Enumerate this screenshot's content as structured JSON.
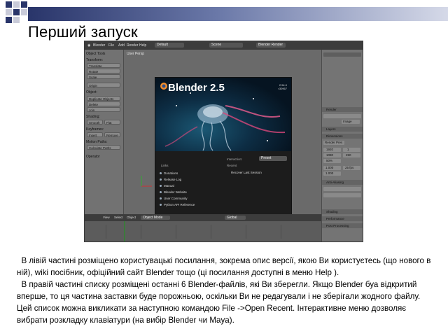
{
  "slide": {
    "title": "Перший запуск",
    "paragraph1": "  В лівій частині розміщено користувацькі посилання, зокрема опис версії, якою Ви користуєтесь (що нового в ній), wiki посібник, офіційний сайт Blender тощо (ці посилання доступні в меню Help ).",
    "paragraph2": "  В правій частині списку розміщені останні 6 Blender-файлів, які Ви зберегли. Якщо Blender буа відкритий вперше, то ця частина заставки буде порожньою, оскільки Ви не редагували і не зберігали жодного файлу. Цей список можна викликати за наступною командою File ->Open Recent. Інтерактивне меню дозволяє вибрати розкладку клавіатури (на вибір Blender чи Maya).",
    "accent_colors": [
      "#29356a",
      "#6a78a8",
      "#d5d9e8"
    ]
  },
  "blender": {
    "window_title": "Blender",
    "menu": [
      "File",
      "Add",
      "Render",
      "Help"
    ],
    "layout_field": "Default",
    "scene_field": "Scene",
    "engine_field": "Blender Render",
    "toolshelf": {
      "header": "Object Tools",
      "sections": [
        {
          "label": "Transform:",
          "buttons": [
            "Translate",
            "Rotate",
            "Scale"
          ]
        },
        {
          "label": "",
          "buttons": [
            "Origin"
          ]
        },
        {
          "label": "Object:",
          "buttons": [
            "Duplicate Objects",
            "Delete",
            "Join"
          ]
        },
        {
          "label": "Shading:",
          "buttons": [
            "Smooth",
            "Flat"
          ]
        },
        {
          "label": "Keyframes:",
          "buttons": [
            "Insert",
            "Remove"
          ]
        },
        {
          "label": "Motion Paths:",
          "buttons": [
            "Calculate Paths"
          ]
        }
      ],
      "operator_label": "Operator"
    },
    "viewport_label": "User Persp",
    "splash": {
      "title": "Blender 2.5",
      "version": "2.54.0\nr30967",
      "links_header": "Links",
      "links": [
        "Donations",
        "Release Log",
        "Manual",
        "Blender Website",
        "User Community",
        "Python API Reference"
      ],
      "interaction_label": "Interaction:",
      "interaction_value": "Preset",
      "recent_label": "Recent",
      "recover_label": "Recover Last Session"
    },
    "bottom_bar": {
      "view": "View",
      "select": "Select",
      "object": "Object",
      "mode": "Object Mode",
      "pivot": "Global"
    },
    "properties": {
      "sections": [
        "Render",
        "Layers",
        "Dimensions",
        "Anti-Aliasing",
        "Shading",
        "Performance",
        "Post Processing"
      ],
      "fields": [
        "Image",
        "Render Pres",
        "1920",
        "1080",
        "50%",
        "1.000",
        "1.000",
        "25 fps",
        "1",
        "250"
      ]
    }
  }
}
